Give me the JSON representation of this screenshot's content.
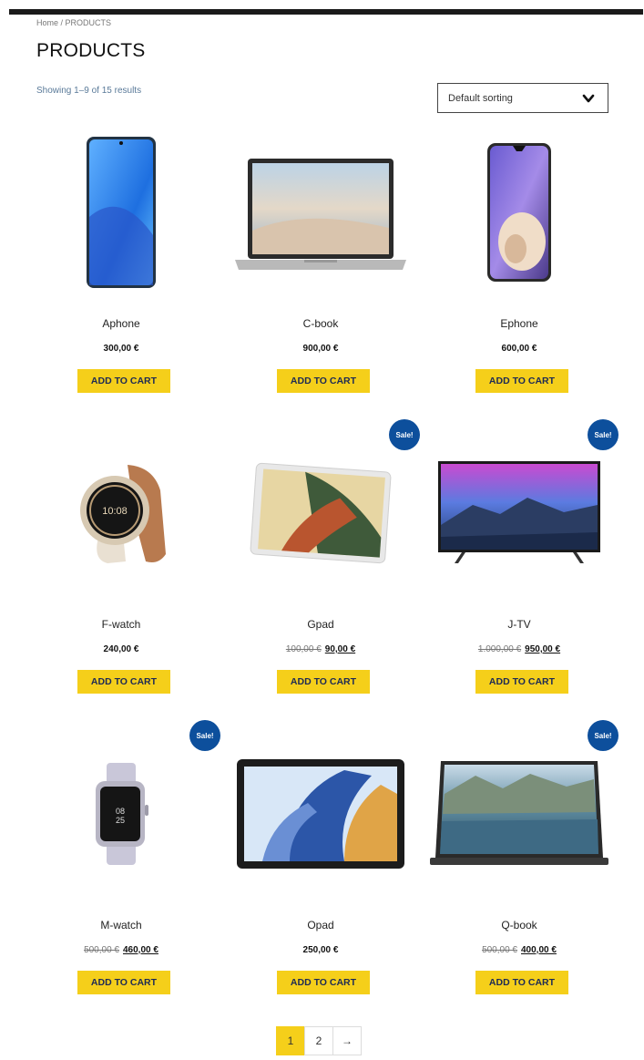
{
  "breadcrumb": "Home / PRODUCTS",
  "page_title": "PRODUCTS",
  "result_count": "Showing 1–9 of 15 results",
  "sorting": {
    "selected": "Default sorting"
  },
  "colors": {
    "button": "#f5cf1a",
    "button_text": "#1d2a55",
    "sale_badge": "#0d4f9c"
  },
  "products": [
    {
      "name": "Aphone",
      "price": "300,00 €",
      "old_price": "",
      "sale": false,
      "button": "ADD TO CART",
      "icon": "phone-image"
    },
    {
      "name": "C-book",
      "price": "900,00 €",
      "old_price": "",
      "sale": false,
      "button": "ADD TO CART",
      "icon": "laptop-image"
    },
    {
      "name": "Ephone",
      "price": "600,00 €",
      "old_price": "",
      "sale": false,
      "button": "ADD TO CART",
      "icon": "phone-image"
    },
    {
      "name": "F-watch",
      "price": "240,00 €",
      "old_price": "",
      "sale": false,
      "button": "ADD TO CART",
      "icon": "smartwatch-image"
    },
    {
      "name": "Gpad",
      "price": "90,00 €",
      "old_price": "100,00 €",
      "sale": true,
      "button": "ADD TO CART",
      "icon": "tablet-image"
    },
    {
      "name": "J-TV",
      "price": "950,00 €",
      "old_price": "1.000,00 €",
      "sale": true,
      "button": "ADD TO CART",
      "icon": "tv-image"
    },
    {
      "name": "M-watch",
      "price": "460,00 €",
      "old_price": "500,00 €",
      "sale": true,
      "button": "ADD TO CART",
      "icon": "smartwatch-image"
    },
    {
      "name": "Opad",
      "price": "250,00 €",
      "old_price": "",
      "sale": false,
      "button": "ADD TO CART",
      "icon": "tablet-image"
    },
    {
      "name": "Q-book",
      "price": "400,00 €",
      "old_price": "500,00 €",
      "sale": true,
      "button": "ADD TO CART",
      "icon": "laptop-image"
    }
  ],
  "sale_label": "Sale!",
  "pagination": {
    "pages": [
      "1",
      "2"
    ],
    "current": "1",
    "next": "→"
  }
}
